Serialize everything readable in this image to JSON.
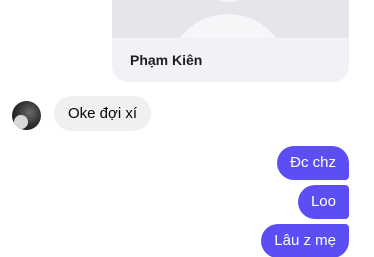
{
  "shared_contact": {
    "name": "Phạm Kiên"
  },
  "messages": [
    {
      "direction": "incoming",
      "text": "Oke đợi xí"
    },
    {
      "direction": "outgoing",
      "text": "Đc chz"
    },
    {
      "direction": "outgoing",
      "text": "Loo"
    },
    {
      "direction": "outgoing",
      "text": "Lâu z mẹ"
    }
  ],
  "colors": {
    "outgoing_bubble": "#5b4ef5",
    "incoming_bubble": "#f0f0f0",
    "card_background": "#f0f2f5"
  }
}
